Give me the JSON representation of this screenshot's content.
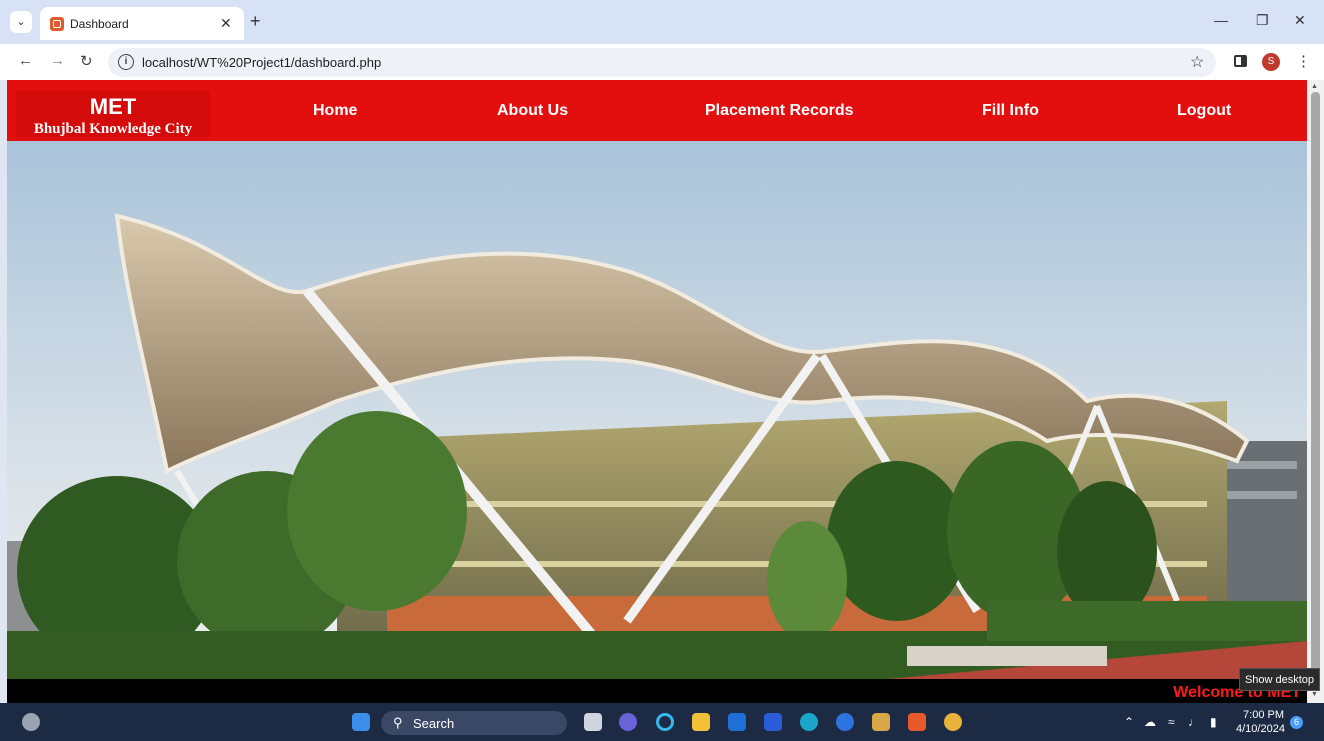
{
  "browser": {
    "tab_title": "Dashboard",
    "url": "localhost/WT%20Project1/dashboard.php",
    "avatar_letter": "S"
  },
  "navbar": {
    "logo_main": "MET",
    "logo_city": "Bhujbal Knowledge City",
    "links": [
      "Home",
      "About Us",
      "Placement Records",
      "Fill Info",
      "Logout"
    ],
    "color": "#e30e0e"
  },
  "marquee": "Welcome to MET",
  "tooltip": "Show desktop",
  "taskbar": {
    "search_label": "Search",
    "time": "7:00 PM",
    "date": "4/10/2024",
    "notification_count": "6"
  }
}
